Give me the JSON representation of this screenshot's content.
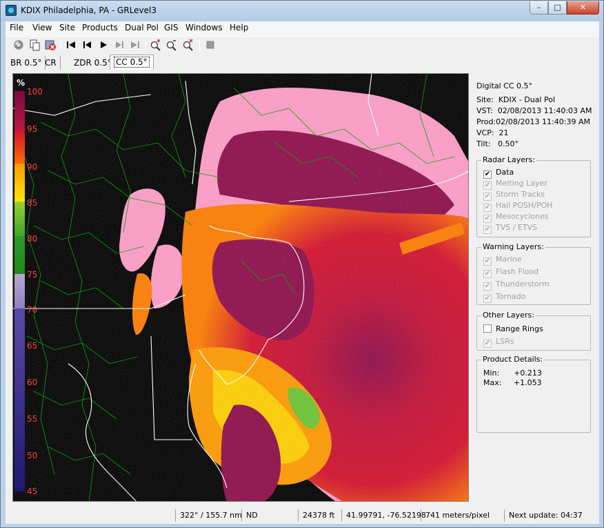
{
  "window": {
    "title": "KDIX Philadelphia, PA - GRLevel3",
    "controls": {
      "minimize": "–",
      "maximize": "□",
      "close": "✕"
    }
  },
  "menu": [
    "File",
    "View",
    "Site",
    "Products",
    "Dual Pol",
    "GIS",
    "Windows",
    "Help"
  ],
  "toolbar": {
    "icons": [
      "reload-icon",
      "copy-icon",
      "stop-icon",
      "first-frame-icon",
      "previous-frame-icon",
      "play-icon",
      "next-frame-icon",
      "last-frame-icon",
      "zoom-in-icon",
      "zoom-out-icon",
      "zoom-reset-icon",
      "stop-loop-icon"
    ]
  },
  "tabs": [
    {
      "label": "BR 0.5°",
      "active": false
    },
    {
      "label": "CR",
      "active": false
    },
    {
      "label": "ZDR 0.5°",
      "active": false
    },
    {
      "label": "CC 0.5°",
      "active": true
    }
  ],
  "colorbar": {
    "unit": "%",
    "ticks": [
      "100",
      "95",
      "90",
      "85",
      "80",
      "75",
      "70",
      "65",
      "60",
      "55",
      "50",
      "45"
    ],
    "colors": {
      "pink": "#ff9dc8",
      "maroon": "#8e0c4a",
      "red": "#d5102d",
      "orange": "#ff7d00",
      "yellow": "#ffdc00",
      "green": "#4ab12b",
      "lavender": "#9a8ec4",
      "navy": "#241b7a"
    }
  },
  "info": {
    "product": "Digital CC 0.5°",
    "site_label": "Site:",
    "site_value": "KDIX - Dual Pol",
    "vst_label": "VST:",
    "vst_value": "02/08/2013  11:40:03 AM",
    "prod_label": "Prod:",
    "prod_value": "02/08/2013  11:40:39 AM",
    "vcp_label": "VCP:",
    "vcp_value": "21",
    "tilt_label": "Tilt:",
    "tilt_value": "0.50°"
  },
  "radar_layers": {
    "title": "Radar Layers:",
    "items": [
      {
        "label": "Data",
        "checked": true,
        "enabled": true
      },
      {
        "label": "Melting Layer",
        "checked": true,
        "enabled": false
      },
      {
        "label": "Storm Tracks",
        "checked": true,
        "enabled": false
      },
      {
        "label": "Hail POSH/POH",
        "checked": true,
        "enabled": false
      },
      {
        "label": "Mesocyclones",
        "checked": true,
        "enabled": false
      },
      {
        "label": "TVS / ETVS",
        "checked": true,
        "enabled": false
      }
    ]
  },
  "warning_layers": {
    "title": "Warning Layers:",
    "items": [
      {
        "label": "Marine",
        "checked": true,
        "enabled": false
      },
      {
        "label": "Flash Flood",
        "checked": true,
        "enabled": false
      },
      {
        "label": "Thunderstorm",
        "checked": true,
        "enabled": false
      },
      {
        "label": "Tornado",
        "checked": true,
        "enabled": false
      }
    ]
  },
  "other_layers": {
    "title": "Other Layers:",
    "items": [
      {
        "label": "Range Rings",
        "checked": false,
        "enabled": true
      },
      {
        "label": "LSRs",
        "checked": true,
        "enabled": false
      }
    ]
  },
  "product_details": {
    "title": "Product Details:",
    "min_label": "Min:",
    "min_value": "+0.213",
    "max_label": "Max:",
    "max_value": "+1.053"
  },
  "status": {
    "azimuth_range": "322° / 155.7 nm",
    "value": "ND",
    "height": "24378 ft",
    "latlon": "41.99791, -76.52198",
    "scale": "741 meters/pixel",
    "next_update": "Next update: 04:37"
  }
}
